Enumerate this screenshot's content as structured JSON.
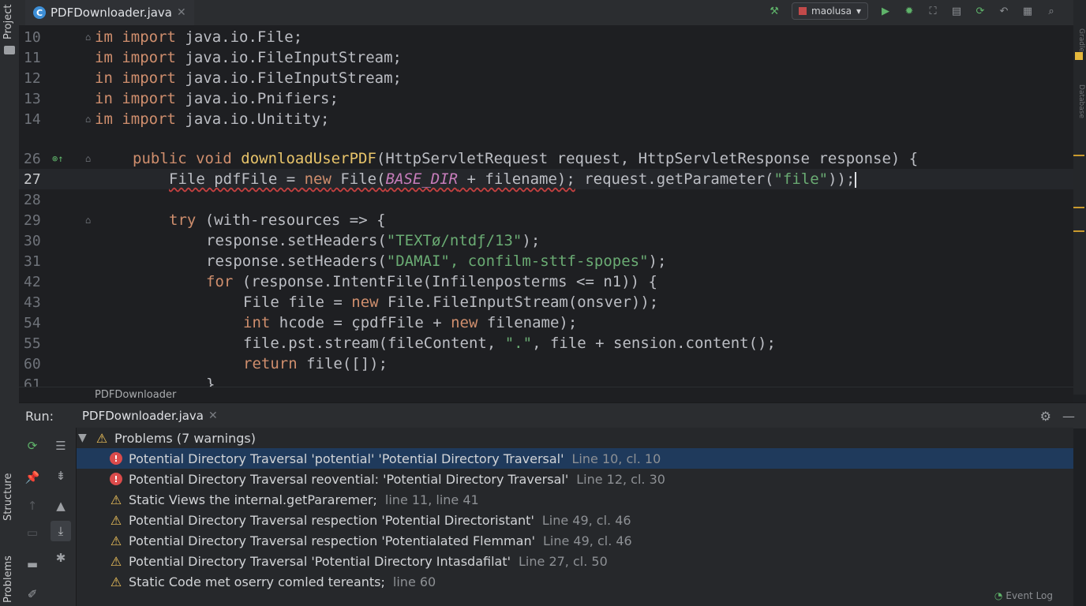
{
  "sidebar": {
    "project_label": "Project",
    "structure_label": "Structure",
    "problems_label": "Problems",
    "right_labels": [
      "Gradle",
      "Database"
    ]
  },
  "tab": {
    "icon_letter": "C",
    "title": "PDFDownloader.java"
  },
  "toolbar": {
    "run_config": "maolusa"
  },
  "editor": {
    "lines": [
      {
        "num": "10",
        "code": "im import java.io.File;"
      },
      {
        "num": "11",
        "code": "im import java.io.FileInputStream;"
      },
      {
        "num": "12",
        "code": "in import java.io.FileInputStream;"
      },
      {
        "num": "13",
        "code": "in import java.io.Pnifiers;"
      },
      {
        "num": "14",
        "code": "im import java.io.Unitity;"
      },
      {
        "num": "26",
        "code": "public void downloadUserPDF(HttpServletRequest request, HttpServletResponse response) {"
      },
      {
        "num": "27",
        "code": "File pdfFile = new File(BASE_DIR + filename); request.getParameter(\"file\"));"
      },
      {
        "num": "28",
        "code": ""
      },
      {
        "num": "29",
        "code": "try (with-resources => {"
      },
      {
        "num": "30",
        "code": "response.setHeaders(\"TEXTø/ntdƒ/13\");"
      },
      {
        "num": "31",
        "code": "response.setHeaders(\"DAMAI\", confilm-sttf-spopes\");"
      },
      {
        "num": "42",
        "code": "for (response.IntentFile(Infilenposterms <= n1)) {"
      },
      {
        "num": "43",
        "code": "File file = new File.FileInputStream(onsver));"
      },
      {
        "num": "54",
        "code": "int hcode = çpdfFile + new filename);"
      },
      {
        "num": "55",
        "code": "file.pst.stream(fileContent, \".\", file + sension.content();"
      },
      {
        "num": "60",
        "code": "return file([]);"
      },
      {
        "num": "61",
        "code": "}"
      }
    ]
  },
  "breadcrumb": {
    "text": "PDFDownloader"
  },
  "run": {
    "label": "Run:",
    "tab_title": "PDFDownloader.java"
  },
  "problems": {
    "header": "Problems (7 warnings)",
    "items": [
      {
        "severity": "error",
        "message": "Potential Directory Traversal  'potential' 'Potential Directory Traversal'",
        "location": "Line 10, cl. 10"
      },
      {
        "severity": "error",
        "message": "Potential Directory Traversal reovential: 'Potential Directory Traversal'",
        "location": "Line 12, cl. 30"
      },
      {
        "severity": "warning",
        "message": "Static Views the internal.getPararemer;",
        "location": "line 11, line 41"
      },
      {
        "severity": "warning",
        "message": "Potential Directory Traversal respection 'Potential Directoristant'",
        "location": "Line 49, cl. 46"
      },
      {
        "severity": "warning",
        "message": "Potential Directory Traversal respection 'Potentialated Flemman'",
        "location": "Line 49, cl. 46"
      },
      {
        "severity": "warning",
        "message": "Potential Directory Traversal 'Potential Directory Intasdafilat'",
        "location": "Line 27, cl. 50"
      },
      {
        "severity": "warning",
        "message": "Static Code met oserry comled tereants;",
        "location": "line 60"
      }
    ]
  },
  "status": {
    "event_log": "Event Log"
  },
  "colors": {
    "accent": "#3574f0",
    "error": "#db4b4b",
    "warning": "#f2c55c",
    "keyword": "#cf8e6d",
    "string": "#6aab73"
  }
}
